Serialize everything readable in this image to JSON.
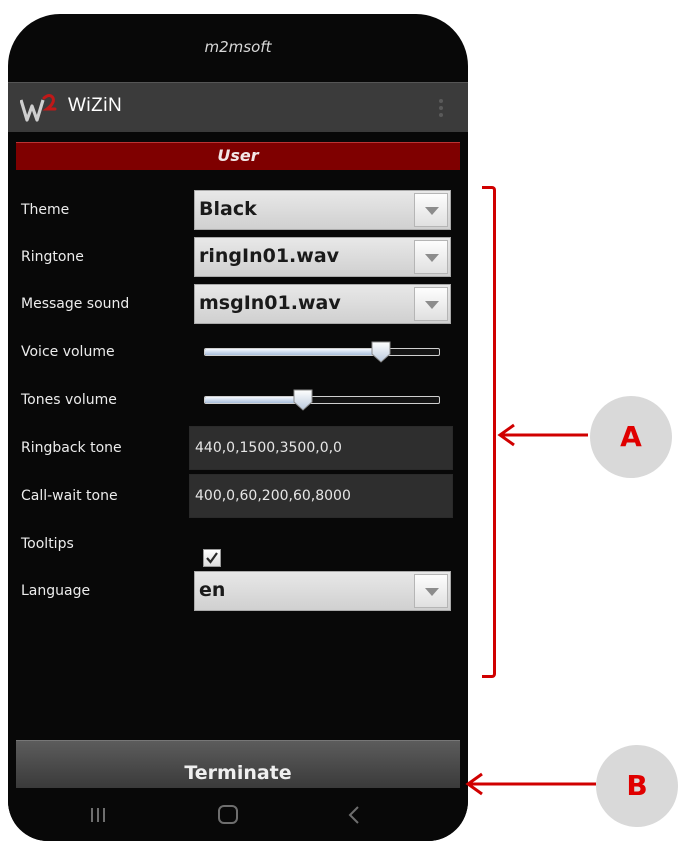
{
  "status_bar": {
    "carrier": "m2msoft"
  },
  "app_bar": {
    "title": "WiZiN",
    "logo_icon": "wizin-w2-logo-icon",
    "menu_icon": "overflow-menu-icon"
  },
  "section": {
    "title": "User"
  },
  "settings": {
    "theme": {
      "label": "Theme",
      "value": "Black"
    },
    "ringtone": {
      "label": "Ringtone",
      "value": "ringIn01.wav"
    },
    "message_sound": {
      "label": "Message sound",
      "value": "msgIn01.wav"
    },
    "voice_volume": {
      "label": "Voice volume",
      "level": 0.75
    },
    "tones_volume": {
      "label": "Tones volume",
      "level": 0.42
    },
    "ringback_tone": {
      "label": "Ringback tone",
      "value": "440,0,1500,3500,0,0"
    },
    "call_wait_tone": {
      "label": "Call-wait tone",
      "value": "400,0,60,200,60,8000"
    },
    "tooltips": {
      "label": "Tooltips",
      "checked": true
    },
    "language": {
      "label": "Language",
      "value": "en"
    }
  },
  "footer": {
    "terminate_label": "Terminate"
  },
  "nav": {
    "icons": [
      "recent-apps-icon",
      "home-icon",
      "back-icon"
    ]
  },
  "annotations": {
    "callout_a": "A",
    "callout_b": "B",
    "accent_color": "#d00000"
  }
}
